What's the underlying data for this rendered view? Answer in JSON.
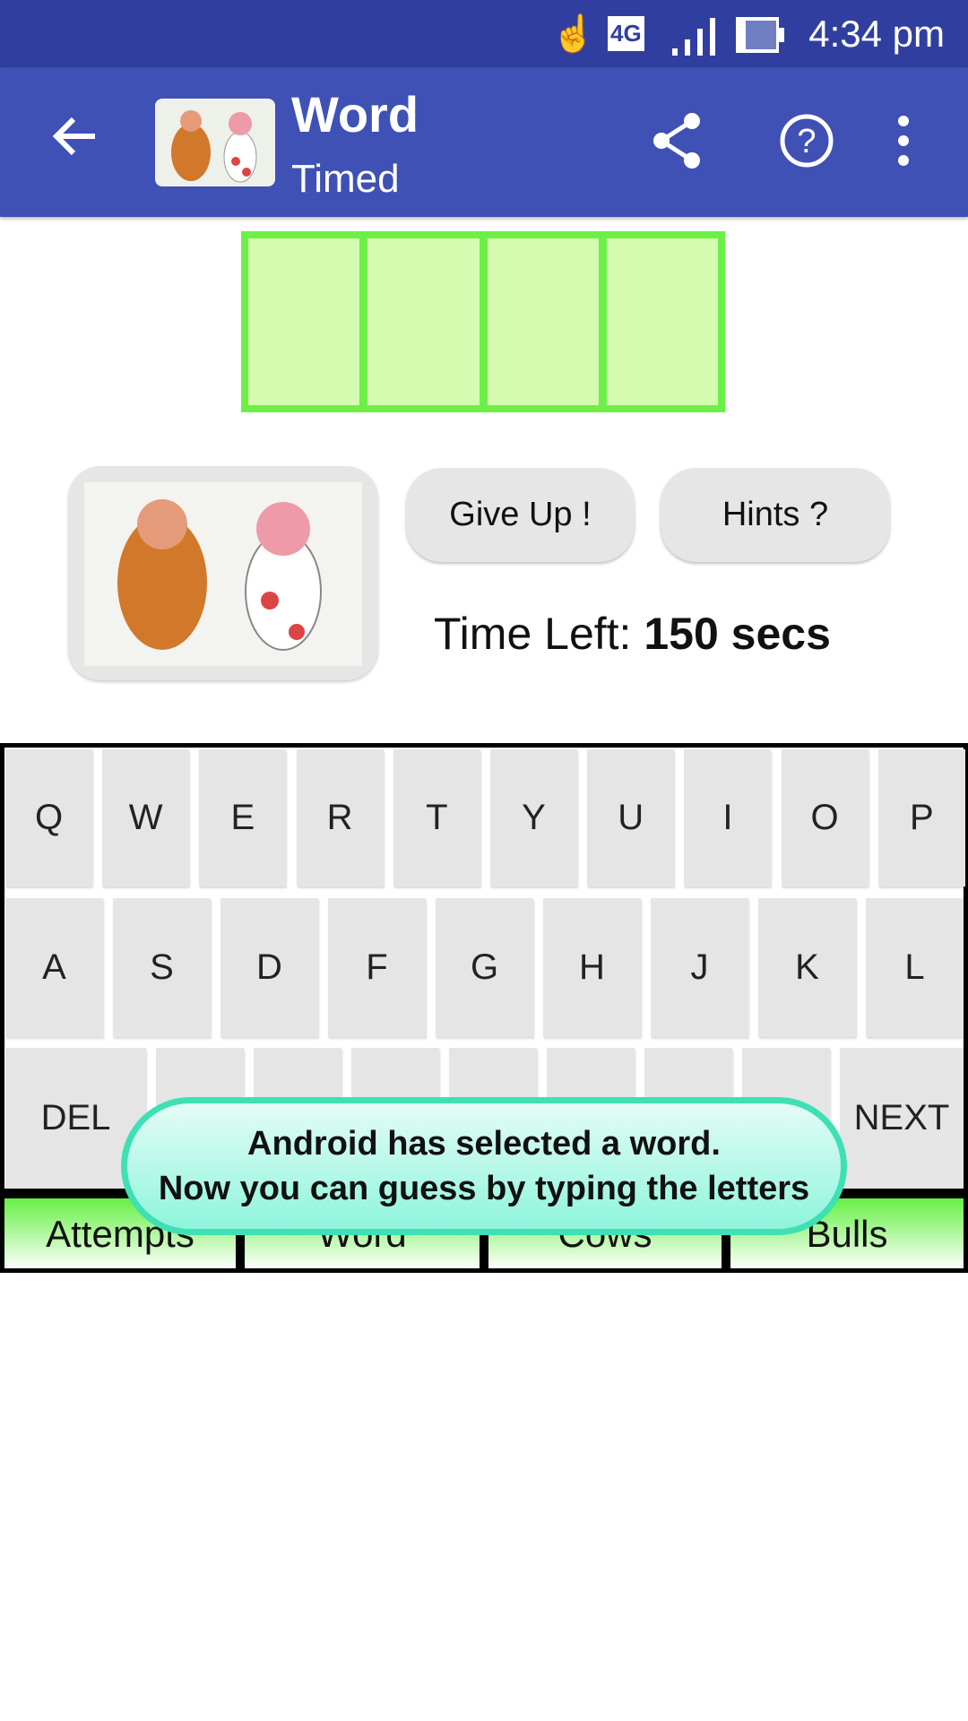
{
  "status_bar": {
    "time": "4:34 pm",
    "network": "4G",
    "icons": [
      "touch-icon",
      "4g-icon",
      "signal-icon",
      "battery-icon"
    ]
  },
  "app_bar": {
    "title": "Word",
    "subtitle": "Timed",
    "icons": [
      "back-arrow-icon",
      "share-icon",
      "help-icon",
      "overflow-menu-icon"
    ]
  },
  "word_slots": [
    "",
    "",
    "",
    ""
  ],
  "buttons": {
    "give_up": "Give Up !",
    "hints": "Hints ?"
  },
  "timer": {
    "label": "Time Left:",
    "value": "150 secs"
  },
  "keyboard": {
    "row1": [
      "Q",
      "W",
      "E",
      "R",
      "T",
      "Y",
      "U",
      "I",
      "O",
      "P"
    ],
    "row2": [
      "A",
      "S",
      "D",
      "F",
      "G",
      "H",
      "J",
      "K",
      "L"
    ],
    "row3": {
      "left": "DEL",
      "right": "NEXT",
      "blank_keys": 7
    }
  },
  "table_headers": [
    "Attempts",
    "Word",
    "Cows",
    "Bulls"
  ],
  "toast": {
    "line1": "Android has selected a word.",
    "line2": "Now you can guess by typing the letters"
  },
  "colors": {
    "status_bar": "#303F9F",
    "app_bar": "#3F51B5",
    "slot_border": "#6CF048",
    "slot_fill": "#D5FBB0",
    "toast_border": "#3EE0B4"
  }
}
